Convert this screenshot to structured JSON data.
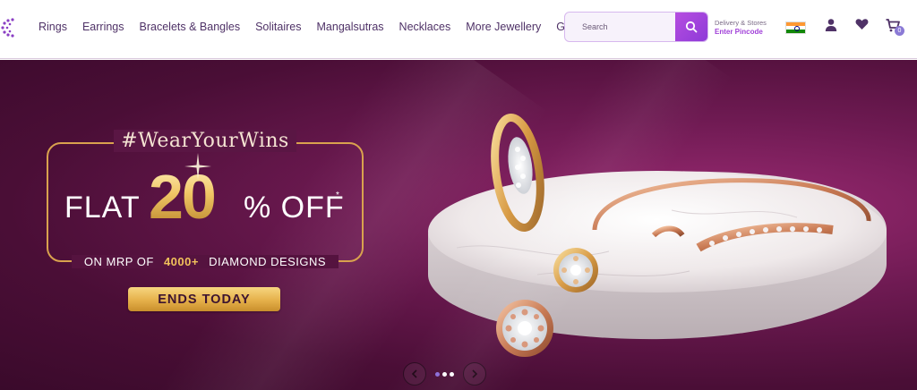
{
  "header": {
    "nav_items": [
      "Rings",
      "Earrings",
      "Bracelets & Bangles",
      "Solitaires",
      "Mangalsutras",
      "Necklaces",
      "More Jewellery",
      "Gifting"
    ],
    "search_placeholder": "Search",
    "delivery_label": "Delivery & Stores",
    "pincode_label": "Enter Pincode",
    "cart_count": "0"
  },
  "hero": {
    "hashtag": "#WearYourWins",
    "flat": "FLAT",
    "amount": "20",
    "off": "% OFF",
    "asterisk": "*",
    "mrp_prefix": "ON MRP OF ",
    "mrp_count": "4000+",
    "mrp_suffix": " DIAMOND DESIGNS",
    "cta": "ENDS TODAY"
  },
  "carousel": {
    "slides": 3,
    "active_index": 0
  },
  "colors": {
    "brand": "#4f3267",
    "accent": "#a03fd8",
    "gold": "#f1c15b",
    "banner": "#6e1a52"
  }
}
